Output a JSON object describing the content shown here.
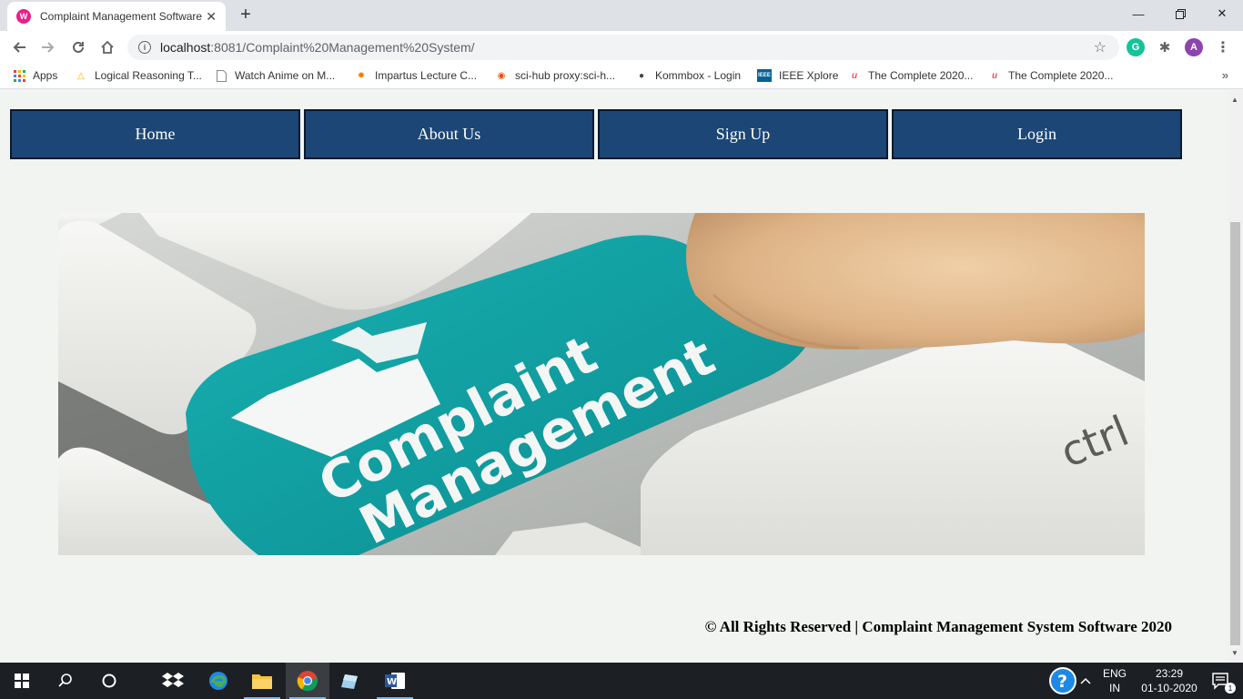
{
  "browser": {
    "tab_title": "Complaint Management Software",
    "tab_favicon": "W",
    "url_host": "localhost",
    "url_path": ":8081/Complaint%20Management%20System/",
    "profile_initial": "A",
    "grammarly_initial": "G"
  },
  "bookmarks": [
    {
      "label": "Apps",
      "icon": "apps-grid-icon"
    },
    {
      "label": "Logical Reasoning T...",
      "icon": "logical-reasoning-icon"
    },
    {
      "label": "Watch Anime on M...",
      "icon": "page-icon"
    },
    {
      "label": "Impartus Lecture C...",
      "icon": "impartus-icon"
    },
    {
      "label": "sci-hub proxy:sci-h...",
      "icon": "scihub-icon"
    },
    {
      "label": "Kommbox - Login",
      "icon": "globe-icon"
    },
    {
      "label": "IEEE Xplore",
      "icon": "ieee-icon"
    },
    {
      "label": "The Complete 2020...",
      "icon": "udemy-icon"
    },
    {
      "label": "The Complete 2020...",
      "icon": "udemy-icon"
    }
  ],
  "nav": {
    "home": "Home",
    "about": "About Us",
    "signup": "Sign Up",
    "login": "Login"
  },
  "hero": {
    "line1": "Complaint",
    "line2": "Management",
    "key_label": "ctrl"
  },
  "footer": {
    "text": "© All Rights Reserved | Complaint Management System Software 2020"
  },
  "taskbar": {
    "lang_line1": "ENG",
    "lang_line2": "IN",
    "time": "23:29",
    "date": "01-10-2020",
    "notification_count": "1"
  },
  "colors": {
    "nav_bg": "#1c4675",
    "nav_border": "#0b1a2b",
    "page_bg": "#f2f4f2",
    "key_teal": "#13a3a6"
  }
}
